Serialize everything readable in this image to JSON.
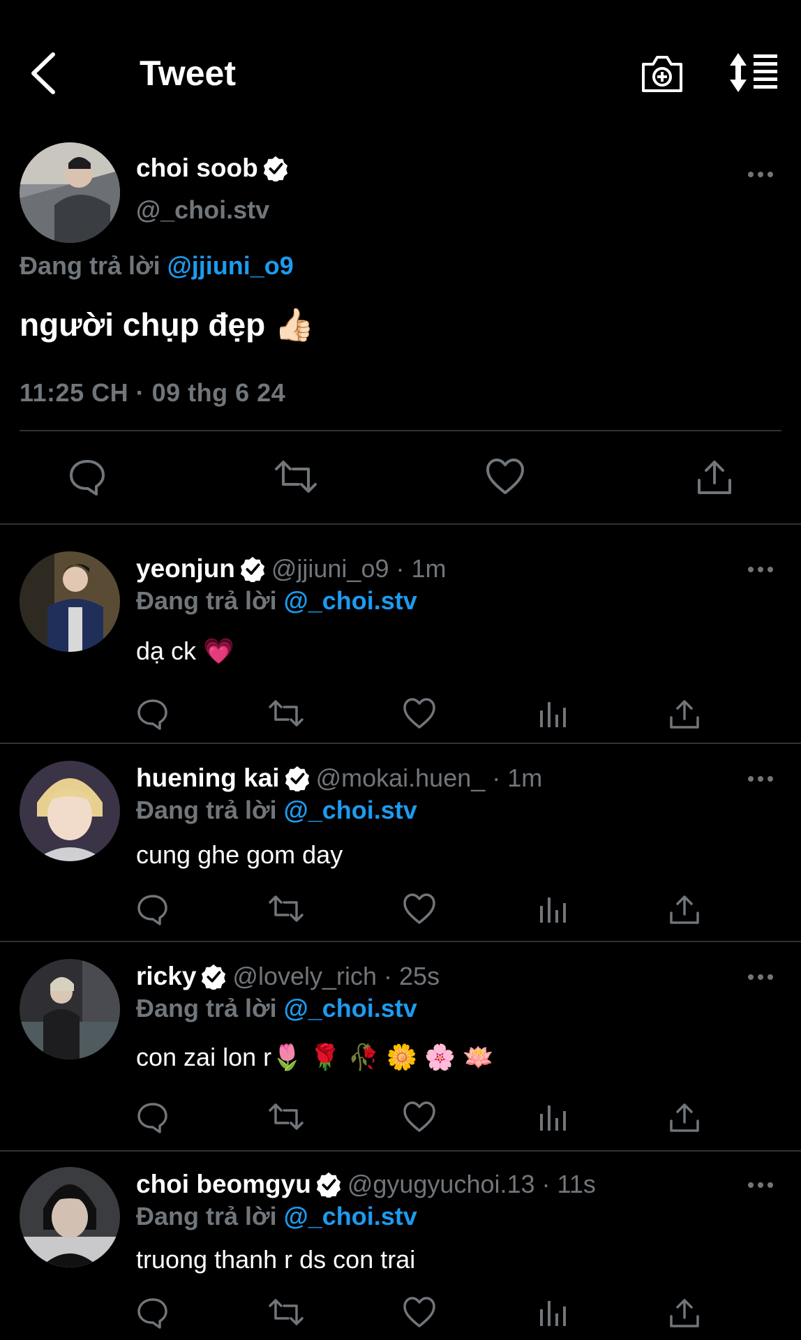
{
  "header": {
    "title": "Tweet",
    "back_icon": "chevron-left-icon",
    "camera_icon": "camera-add-icon",
    "sort_icon": "sort-icon"
  },
  "main_tweet": {
    "name": "choi soob",
    "handle": "@_choi.stv",
    "replying_prefix": "Đang trả lời",
    "replying_to": "@jjiuni_o9",
    "text": "người chụp đẹp 👍🏻",
    "timestamp": "11:25 CH · 09 thg 6 24",
    "verified": true
  },
  "replies": [
    {
      "name": "yeonjun",
      "handle": "@jjiuni_o9 · 1m",
      "replying_prefix": "Đang trả lời",
      "replying_to": "@_choi.stv",
      "text": "dạ ck 💗"
    },
    {
      "name": "huening kai",
      "handle": "@mokai.huen_ · 1m",
      "replying_prefix": "Đang trả lời",
      "replying_to": "@_choi.stv",
      "text": "cung ghe gom day"
    },
    {
      "name": "ricky",
      "handle": "@lovely_rich · 25s",
      "replying_prefix": "Đang trả lời",
      "replying_to": "@_choi.stv",
      "text": "con zai lon r🌷 🌹 🥀 🌼 🌸 🪷"
    },
    {
      "name": "choi beomgyu",
      "handle": "@gyugyuchoi.13 · 11s",
      "replying_prefix": "Đang trả lời",
      "replying_to": "@_choi.stv",
      "text": "truong thanh r ds con trai"
    }
  ],
  "colors": {
    "background": "#000000",
    "accent": "#1d9bf0",
    "muted": "#71767b",
    "separator": "#2f3336"
  }
}
